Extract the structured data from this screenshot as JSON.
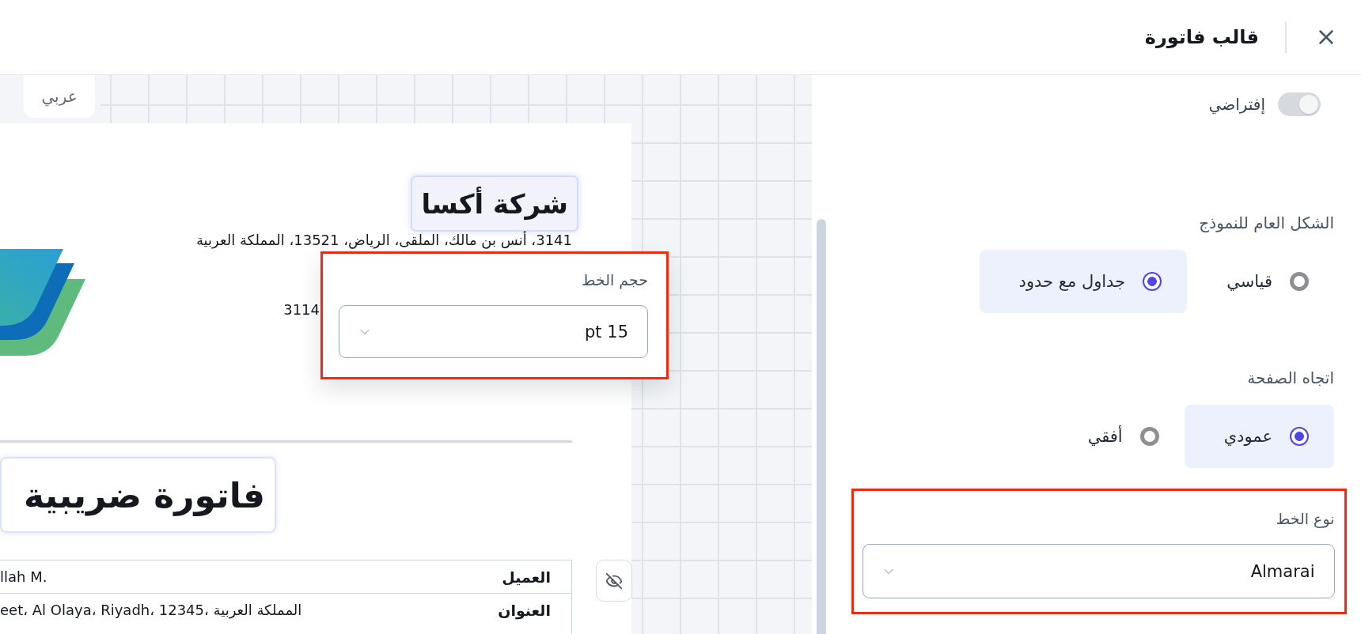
{
  "header": {
    "title": "قالب فاتورة"
  },
  "preview": {
    "language_tabs": [
      {
        "label": "عربي",
        "selected": true
      }
    ],
    "company": {
      "name": "شركة أكسا",
      "address": "3141، أنس بن مالك، الملقى، الرياض، 13521، المملكة العربية",
      "line_2": "3114"
    },
    "title": "فاتورة ضريبية",
    "details": [
      {
        "label": "العميل",
        "value": "llah M."
      },
      {
        "label": "العنوان",
        "value": "eet، Al Olaya، Riyadh، 12345، المملكة العربية"
      }
    ],
    "font_size": {
      "label": "حجم الخط",
      "value": "pt 15",
      "highlighted": true
    }
  },
  "settings": {
    "default_toggle": {
      "label": "إفتراضي",
      "on": true,
      "disabled": true
    },
    "layout": {
      "label": "الشكل العام للنموذج",
      "options": [
        {
          "label": "قياسي",
          "selected": false
        },
        {
          "label": "جداول مع حدود",
          "selected": true
        }
      ]
    },
    "orientation": {
      "label": "اتجاه الصفحة",
      "options": [
        {
          "label": "عمودي",
          "selected": true
        },
        {
          "label": "أفقي",
          "selected": false
        }
      ]
    },
    "font_type": {
      "label": "نوع الخط",
      "value": "Almarai",
      "highlighted": true
    }
  }
}
